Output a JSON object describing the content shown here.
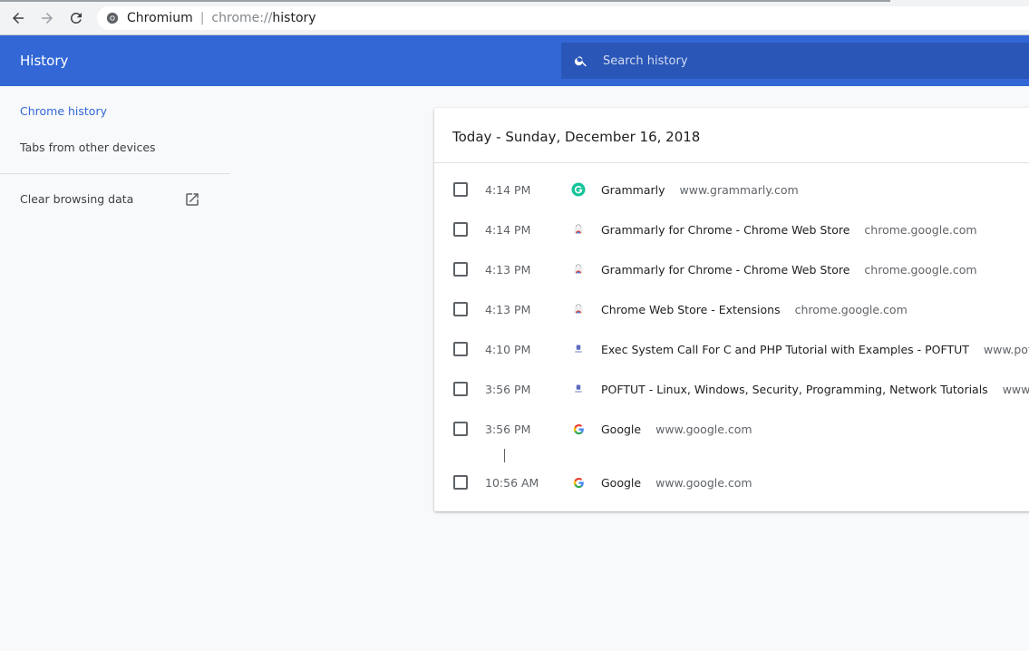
{
  "browser": {
    "site_name": "Chromium",
    "url_scheme": "chrome://",
    "url_path": "history"
  },
  "header": {
    "title": "History",
    "search_placeholder": "Search history"
  },
  "sidebar": {
    "items": [
      {
        "label": "Chrome history",
        "active": true
      },
      {
        "label": "Tabs from other devices",
        "active": false
      }
    ],
    "clear_label": "Clear browsing data"
  },
  "history": {
    "date_heading": "Today - Sunday, December 16, 2018",
    "entries": [
      {
        "time": "4:14 PM",
        "title": "Grammarly",
        "domain": "www.grammarly.com",
        "icon": "grammarly-icon"
      },
      {
        "time": "4:14 PM",
        "title": "Grammarly for Chrome - Chrome Web Store",
        "domain": "chrome.google.com",
        "icon": "chrome-web-store-icon"
      },
      {
        "time": "4:13 PM",
        "title": "Grammarly for Chrome - Chrome Web Store",
        "domain": "chrome.google.com",
        "icon": "chrome-web-store-icon"
      },
      {
        "time": "4:13 PM",
        "title": "Chrome Web Store - Extensions",
        "domain": "chrome.google.com",
        "icon": "chrome-web-store-icon"
      },
      {
        "time": "4:10 PM",
        "title": "Exec System Call For C and PHP Tutorial with Examples - POFTUT",
        "domain": "www.poftut.c",
        "icon": "poftut-icon"
      },
      {
        "time": "3:56 PM",
        "title": "POFTUT - Linux, Windows, Security, Programming, Network Tutorials",
        "domain": "www.poftut",
        "icon": "poftut-icon"
      },
      {
        "time": "3:56 PM",
        "title": "Google",
        "domain": "www.google.com",
        "icon": "google-icon"
      },
      {
        "time": "10:56 AM",
        "title": "Google",
        "domain": "www.google.com",
        "icon": "google-icon"
      }
    ]
  },
  "colors": {
    "header": "#3367d6",
    "accent": "#3367d6",
    "background": "#f8f9fa"
  }
}
